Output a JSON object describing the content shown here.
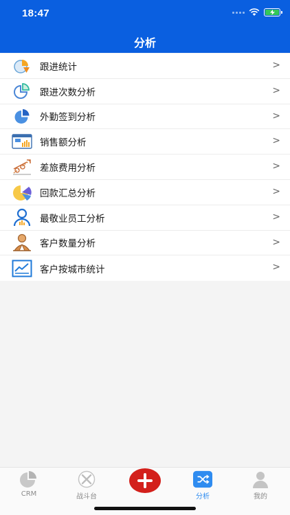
{
  "status_bar": {
    "time": "18:47"
  },
  "header": {
    "title": "分析"
  },
  "menu": [
    {
      "label": "跟进统计",
      "icon": "pie-chart-icon",
      "chevron": ">"
    },
    {
      "label": "跟进次数分析",
      "icon": "pie-segment-icon",
      "chevron": ">"
    },
    {
      "label": "外勤签到分析",
      "icon": "pie-blue-icon",
      "chevron": ">"
    },
    {
      "label": "销售额分析",
      "icon": "sales-chart-icon",
      "chevron": ">"
    },
    {
      "label": "差旅费用分析",
      "icon": "travel-expense-icon",
      "chevron": ">"
    },
    {
      "label": "回款汇总分析",
      "icon": "payment-pie-icon",
      "chevron": ">"
    },
    {
      "label": "最敬业员工分析",
      "icon": "employee-icon",
      "chevron": ">"
    },
    {
      "label": "客户数量分析",
      "icon": "customer-icon",
      "chevron": ">"
    },
    {
      "label": "客户按城市统计",
      "icon": "city-stats-icon",
      "chevron": ">"
    }
  ],
  "tabbar": {
    "items": [
      {
        "label": "CRM",
        "icon": "crm-pie-icon",
        "active": false
      },
      {
        "label": "战斗台",
        "icon": "battle-icon",
        "active": false
      },
      {
        "label": "",
        "icon": "add-icon",
        "active": false
      },
      {
        "label": "分析",
        "icon": "shuffle-icon",
        "active": true
      },
      {
        "label": "我的",
        "icon": "profile-icon",
        "active": false
      }
    ]
  },
  "colors": {
    "header_bg": "#0a5fe0",
    "accent": "#2f8cf0",
    "add_button": "#d3201b"
  }
}
